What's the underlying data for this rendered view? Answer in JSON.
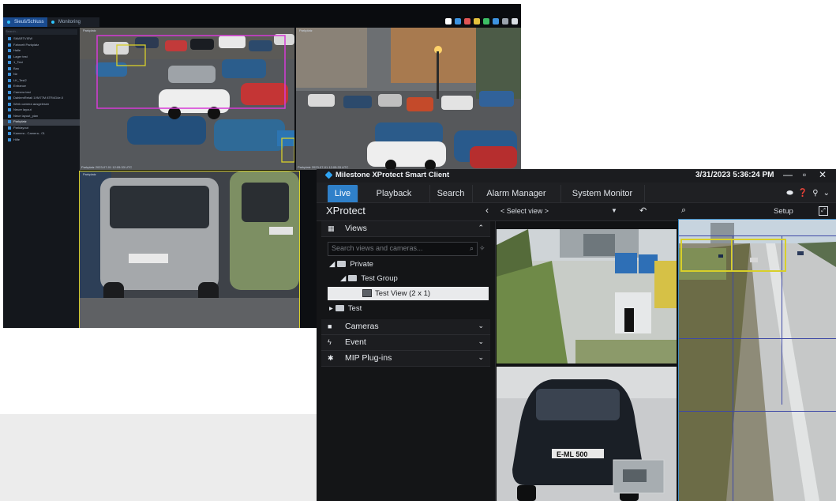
{
  "back_window": {
    "tabs": [
      "Sieuš/Schluss",
      "Monitoring"
    ],
    "tree": {
      "search": "Search...",
      "items": [
        "SMARTVIEW",
        "Fahrzeit Parkplatz",
        "Halle",
        "Lager test",
        "1_Test",
        "Bau",
        "Ne",
        "LK_Test2",
        "Entrance",
        "Camera test",
        "DahlemRetail 1VM77M 8TR4G4e.0",
        "Werk camera ausgelesen",
        "Neuer layout",
        "Neue layout_plan",
        "Parkplatz",
        "Parklayout",
        "Kamera - Camera - 01",
        "Hilfe"
      ],
      "selected_index": 14
    },
    "cells": [
      {
        "label": "Parkplatz",
        "footer": "Parkplatz 2023-07-01 12:05:33 UTC"
      },
      {
        "label": "Parkplatz",
        "footer": "Parkplatz 2023-07-01 12:05:33 UTC"
      },
      {
        "label": "Parkplatz",
        "footer": ""
      }
    ]
  },
  "front_window": {
    "title": "Milestone XProtect Smart Client",
    "clock": "3/31/2023 5:36:24 PM",
    "tabs": [
      "Live",
      "Playback",
      "Search",
      "Alarm Manager",
      "System Monitor"
    ],
    "active_tab": "Live",
    "xprotect_label": "XProtect",
    "select_view": "< Select view >",
    "setup_label": "Setup",
    "views_header": "Views",
    "search_placeholder": "Search views and cameras...",
    "tree": {
      "private": "Private",
      "test_group": "Test Group",
      "test_view": "Test View (2 x 1)",
      "test": "Test"
    },
    "panels": [
      "Cameras",
      "Event",
      "MIP Plug-ins"
    ],
    "plate_text": "E-ML 500"
  },
  "colors": {
    "accent": "#2f80c9",
    "back_tab_active": "#1a4b8f",
    "overlay_magenta": "#d63ad6",
    "overlay_yellow": "#d8cf2a",
    "overlay_blue": "#3e49a6"
  }
}
